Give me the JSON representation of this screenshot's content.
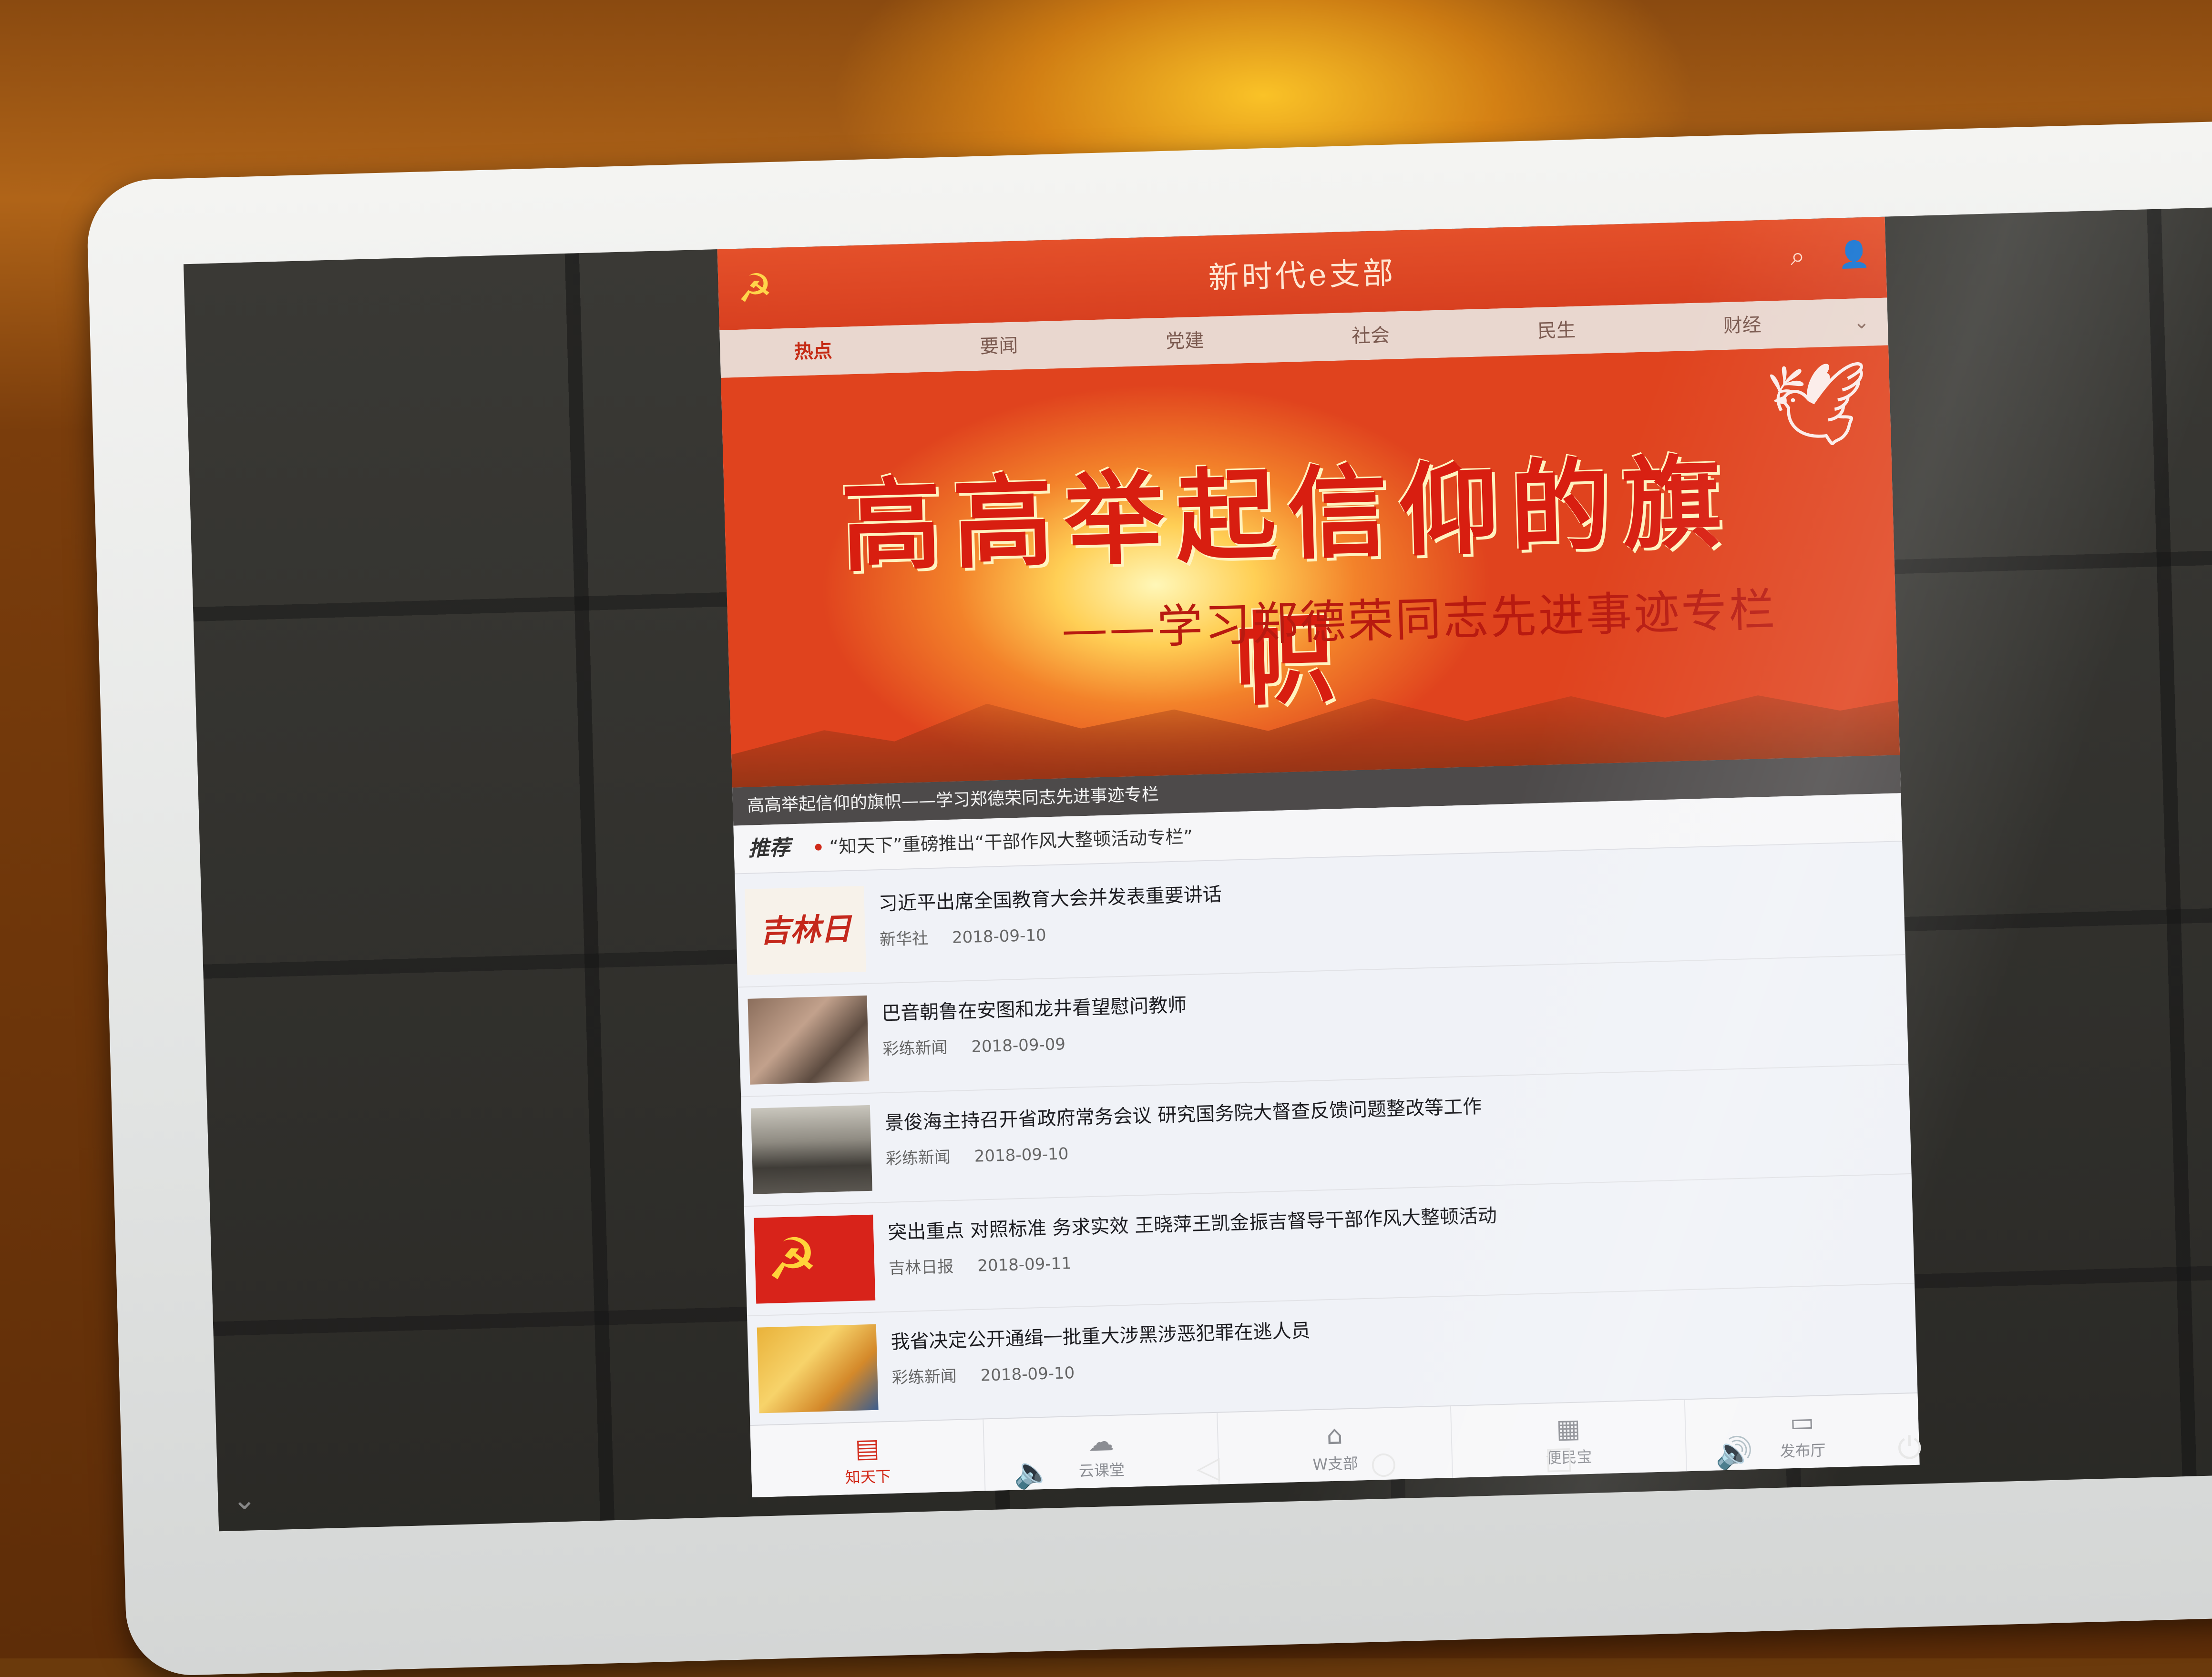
{
  "app": {
    "title": "新时代e支部",
    "tabs": [
      "热点",
      "要闻",
      "党建",
      "社会",
      "民生",
      "财经"
    ]
  },
  "banner": {
    "headline": "高高举起信仰的旗帜",
    "subline": "——学习郑德荣同志先进事迹专栏",
    "caption": "高高举起信仰的旗帜——学习郑德荣同志先进事迹专栏"
  },
  "recommend": {
    "label": "推荐",
    "text": "“知天下”重磅推出“干部作风大整顿活动专栏”"
  },
  "news": [
    {
      "title": "习近平出席全国教育大会并发表重要讲话",
      "source": "新华社",
      "date": "2018-09-10",
      "thumb": "吉林日报"
    },
    {
      "title": "巴音朝鲁在安图和龙井看望慰问教师",
      "source": "彩练新闻",
      "date": "2018-09-09"
    },
    {
      "title": "景俊海主持召开省政府常务会议 研究国务院大督查反馈问题整改等工作",
      "source": "彩练新闻",
      "date": "2018-09-10"
    },
    {
      "title": "突出重点 对照标准 务求实效 王晓萍王凯金振吉督导干部作风大整顿活动",
      "source": "吉林日报",
      "date": "2018-09-11"
    },
    {
      "title": "我省决定公开通缉一批重大涉黑涉恶犯罪在逃人员",
      "source": "彩练新闻",
      "date": "2018-09-10"
    }
  ],
  "bottom_nav": [
    "知天下",
    "云课堂",
    "W支部",
    "便民宝",
    "发布厅"
  ],
  "icons": {
    "logo": "party-emblem-icon",
    "search": "search-icon",
    "user": "user-icon",
    "more": "chevron-down-icon",
    "dove": "dove-icon",
    "nav": [
      "newspaper-icon",
      "cloud-icon",
      "home-icon",
      "grid-icon",
      "chat-icon"
    ],
    "system": [
      "volume-down-icon",
      "back-icon",
      "home-circle-icon",
      "recents-icon",
      "volume-up-icon",
      "power-icon"
    ]
  },
  "colors": {
    "header_red": "#d84020",
    "active_red": "#d22a1a"
  }
}
